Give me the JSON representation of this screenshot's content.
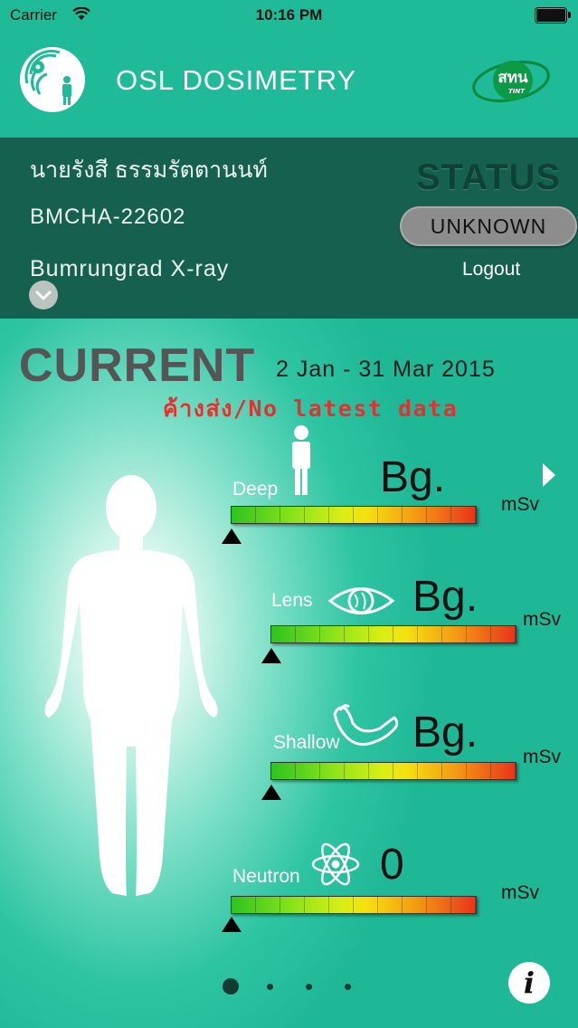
{
  "status_bar": {
    "carrier": "Carrier",
    "time": "10:16 PM"
  },
  "header": {
    "title": "OSL DOSIMETRY",
    "partner_logo_text": "สทน",
    "partner_logo_subtext": "TINT"
  },
  "user": {
    "name": "นายรังสี ธรรมรัตตานนท์",
    "id": "BMCHA-22602",
    "organization": "Bumrungrad X-ray"
  },
  "status": {
    "label": "STATUS",
    "value": "UNKNOWN",
    "logout_label": "Logout"
  },
  "current": {
    "label": "CURRENT",
    "date_range": "2 Jan - 31 Mar 2015",
    "warning": "ค้างส่ง/No latest data"
  },
  "meters": {
    "deep": {
      "label": "Deep",
      "value": "Bg.",
      "unit": "mSv",
      "icon": "person-icon"
    },
    "lens": {
      "label": "Lens",
      "value": "Bg.",
      "unit": "mSv",
      "icon": "eye-icon"
    },
    "shallow": {
      "label": "Shallow",
      "value": "Bg.",
      "unit": "mSv",
      "icon": "arm-icon"
    },
    "neutron": {
      "label": "Neutron",
      "value": "0",
      "unit": "mSv",
      "icon": "atom-icon"
    }
  },
  "pagination": {
    "pages": 4,
    "active": 1
  },
  "info_button": {
    "label": "i"
  },
  "colors": {
    "background": "#1fba98",
    "panel": "#16604f",
    "warning": "#e4312f"
  }
}
